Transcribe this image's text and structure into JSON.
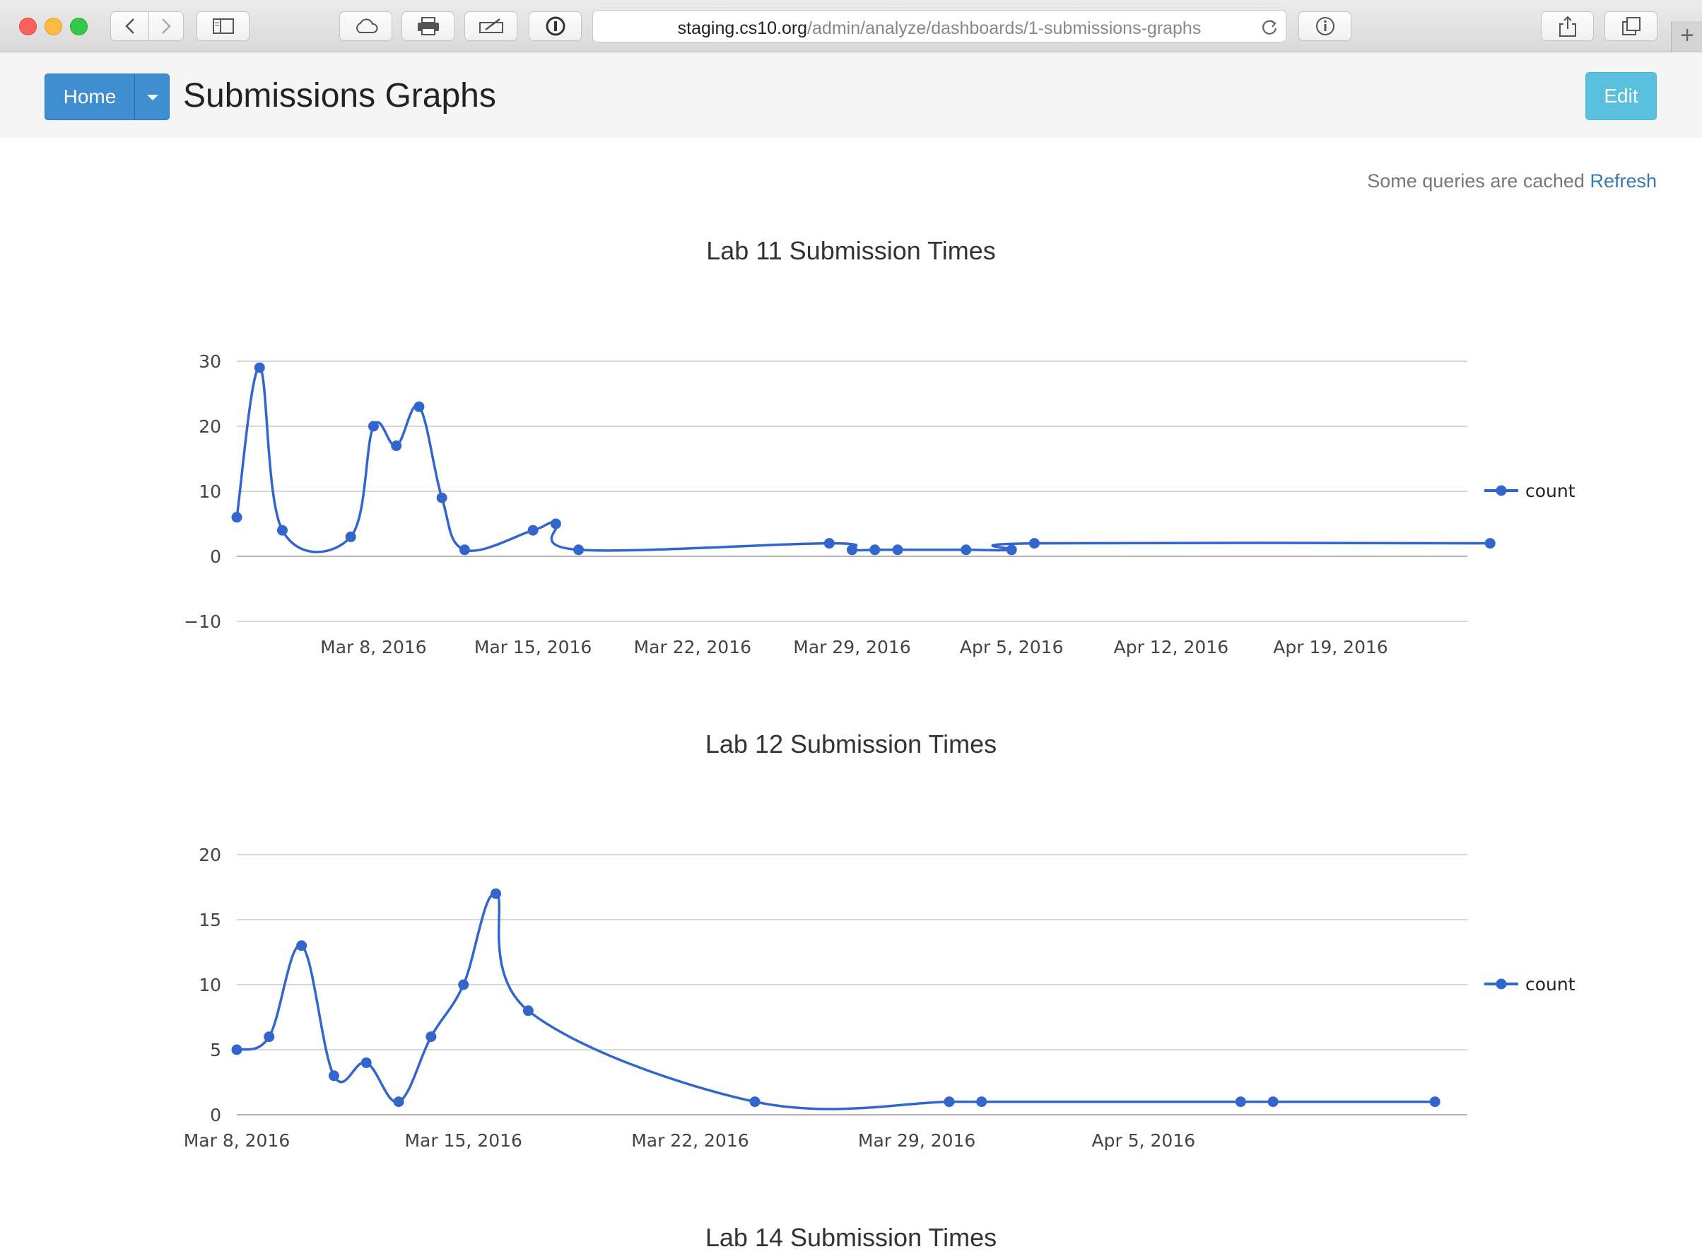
{
  "browser": {
    "url_host": "staging.cs10.org",
    "url_path": "/admin/analyze/dashboards/1-submissions-graphs"
  },
  "header": {
    "home_label": "Home",
    "title": "Submissions Graphs",
    "edit_label": "Edit"
  },
  "cache_notice": {
    "text": "Some queries are cached",
    "link": "Refresh"
  },
  "colors": {
    "series": "#3366cc",
    "grid": "#cccccc",
    "primary": "#3f8fd0",
    "info": "#5bc0de"
  },
  "chart_data": [
    {
      "type": "line",
      "title": "Lab 11 Submission Times",
      "xlabel": "",
      "ylabel": "",
      "ylim": [
        -10,
        30
      ],
      "yticks": [
        30,
        20,
        10,
        0,
        -10
      ],
      "x_date_range": [
        "2016-03-02",
        "2016-04-25"
      ],
      "xticks": [
        "2016-03-08",
        "2016-03-15",
        "2016-03-22",
        "2016-03-29",
        "2016-04-05",
        "2016-04-12",
        "2016-04-19"
      ],
      "xtick_labels": [
        "Mar 8, 2016",
        "Mar 15, 2016",
        "Mar 22, 2016",
        "Mar 29, 2016",
        "Apr 5, 2016",
        "Apr 12, 2016",
        "Apr 19, 2016"
      ],
      "legend_position": "right",
      "series": [
        {
          "name": "count",
          "x": [
            "2016-03-02",
            "2016-03-03",
            "2016-03-04",
            "2016-03-07",
            "2016-03-08",
            "2016-03-09",
            "2016-03-10",
            "2016-03-11",
            "2016-03-12",
            "2016-03-15",
            "2016-03-16",
            "2016-03-17",
            "2016-03-28",
            "2016-03-29",
            "2016-03-30",
            "2016-03-31",
            "2016-04-03",
            "2016-04-05",
            "2016-04-06",
            "2016-04-26"
          ],
          "values": [
            6,
            29,
            4,
            3,
            20,
            17,
            23,
            9,
            1,
            4,
            5,
            1,
            2,
            1,
            1,
            1,
            1,
            1,
            2,
            2
          ]
        }
      ]
    },
    {
      "type": "line",
      "title": "Lab 12 Submission Times",
      "xlabel": "",
      "ylabel": "",
      "ylim": [
        0,
        20
      ],
      "yticks": [
        20,
        15,
        10,
        5,
        0
      ],
      "x_date_range": [
        "2016-03-08",
        "2016-04-15"
      ],
      "xticks": [
        "2016-03-08",
        "2016-03-15",
        "2016-03-22",
        "2016-03-29",
        "2016-04-05"
      ],
      "xtick_labels": [
        "Mar 8, 2016",
        "Mar 15, 2016",
        "Mar 22, 2016",
        "Mar 29, 2016",
        "Apr 5, 2016"
      ],
      "legend_position": "right",
      "series": [
        {
          "name": "count",
          "x": [
            "2016-03-08",
            "2016-03-09",
            "2016-03-10",
            "2016-03-11",
            "2016-03-12",
            "2016-03-13",
            "2016-03-14",
            "2016-03-15",
            "2016-03-16",
            "2016-03-17",
            "2016-03-24",
            "2016-03-30",
            "2016-03-31",
            "2016-04-08",
            "2016-04-09",
            "2016-04-14"
          ],
          "values": [
            5,
            6,
            13,
            3,
            4,
            1,
            6,
            10,
            17,
            8,
            1,
            1,
            1,
            1,
            1,
            1
          ]
        }
      ]
    },
    {
      "type": "line",
      "title": "Lab 14 Submission Times"
    }
  ]
}
